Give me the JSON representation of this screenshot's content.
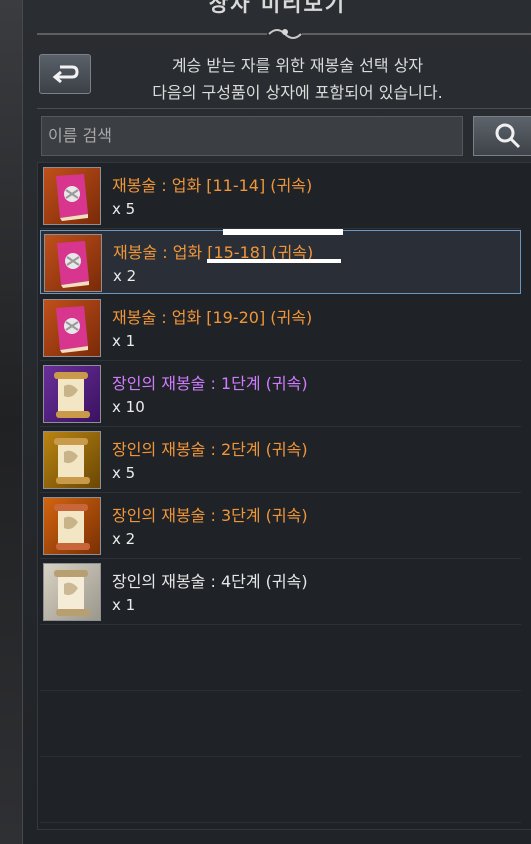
{
  "window": {
    "title": "상자 미리보기"
  },
  "description": {
    "line1": "계승 받는 자를 위한 재봉술 선택 상자",
    "line2": "다음의 구성품이 상자에 포함되어 있습니다."
  },
  "search": {
    "placeholder": "이름 검색"
  },
  "colors": {
    "orange": "#f0963a",
    "purple": "#d07cff",
    "white": "#e6e6e6",
    "selection": "#6a97c0"
  },
  "items": [
    {
      "name": "재봉술 : 업화 [11-14] (귀속)",
      "qty": "x 5",
      "color": "#f0963a",
      "icon": "pink-book-icon"
    },
    {
      "name": "재봉술 : 업화 [15-18] (귀속)",
      "qty": "x 2",
      "color": "#f0963a",
      "icon": "pink-book-icon"
    },
    {
      "name": "재봉술 : 업화 [19-20] (귀속)",
      "qty": "x 1",
      "color": "#f0963a",
      "icon": "pink-book-icon"
    },
    {
      "name": "장인의 재봉술 : 1단계 (귀속)",
      "qty": "x 10",
      "color": "#d07cff",
      "icon": "purple-scroll-icon"
    },
    {
      "name": "장인의 재봉술 : 2단계 (귀속)",
      "qty": "x 5",
      "color": "#f0963a",
      "icon": "gold-scroll-icon"
    },
    {
      "name": "장인의 재봉술 : 3단계 (귀속)",
      "qty": "x 2",
      "color": "#f0963a",
      "icon": "orange-scroll-icon"
    },
    {
      "name": "장인의 재봉술 : 4단계 (귀속)",
      "qty": "x 1",
      "color": "#e6e6e6",
      "icon": "white-scroll-icon"
    }
  ]
}
